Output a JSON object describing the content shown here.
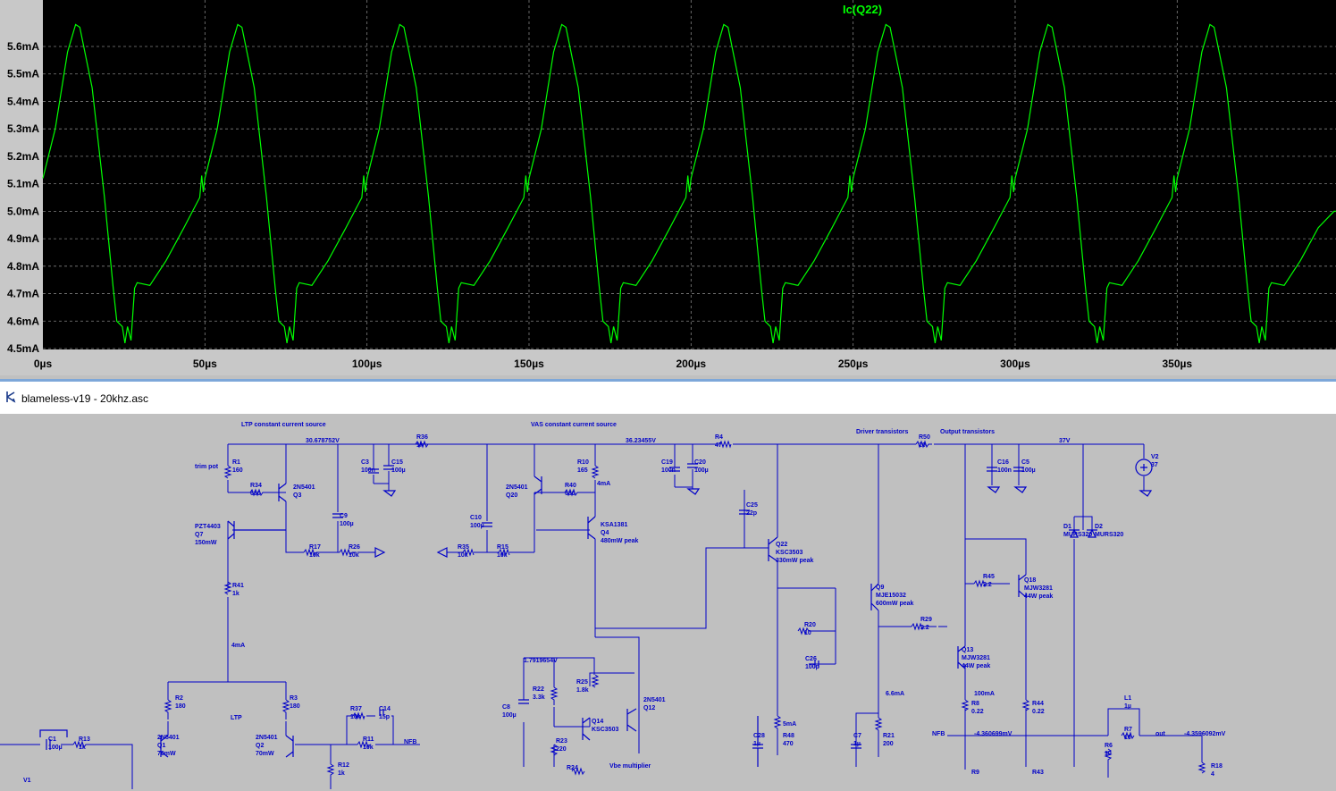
{
  "plot": {
    "trace_name": "Ic(Q22)",
    "trace_color": "#00ff00",
    "background": "#000000",
    "grid_color": "#808080"
  },
  "chart_data": {
    "type": "line",
    "title": "Ic(Q22)",
    "xlabel": "",
    "ylabel": "",
    "xlim": [
      0,
      399
    ],
    "ylim": [
      4.5,
      5.7
    ],
    "grid": true,
    "x_unit": "µs",
    "y_unit": "mA",
    "x_tick_labels": [
      "0µs",
      "50µs",
      "100µs",
      "150µs",
      "200µs",
      "250µs",
      "300µs",
      "350µs"
    ],
    "y_tick_labels": [
      "5.6mA",
      "5.5mA",
      "5.4mA",
      "5.3mA",
      "5.2mA",
      "5.1mA",
      "5.0mA",
      "4.9mA",
      "4.8mA",
      "4.7mA",
      "4.6mA",
      "4.5mA"
    ],
    "y_tick_values": [
      5.6,
      5.5,
      5.4,
      5.3,
      5.2,
      5.1,
      5.0,
      4.9,
      4.8,
      4.7,
      4.6,
      4.5
    ],
    "x_tick_values": [
      0,
      50,
      100,
      150,
      200,
      250,
      300,
      350
    ],
    "series": [
      {
        "name": "Ic(Q22)",
        "period_us": 50,
        "x": [
          0,
          3.8,
          7.6,
          10.1,
          11.4,
          15.2,
          19.0,
          21.7,
          22.8,
          24.5,
          25.3,
          26.1,
          27.2,
          28.3,
          29.1,
          33.0,
          38.0,
          43.5,
          48.4,
          49.0,
          49.5,
          50.0,
          53.8,
          57.6,
          60.1,
          61.4,
          65.2,
          69.0,
          71.7,
          72.8,
          74.5,
          75.3,
          76.1,
          77.2,
          78.3,
          79.1,
          83.0,
          88.0,
          93.5,
          98.4,
          99.0,
          99.5,
          100.0,
          103.8,
          107.6,
          110.1,
          111.4,
          115.2,
          119.0,
          121.7,
          122.8,
          124.5,
          125.3,
          126.1,
          127.2,
          128.3,
          129.1,
          133.0,
          138.0,
          143.5,
          148.4,
          149.0,
          149.5,
          150.0,
          153.8,
          157.6,
          160.1,
          161.4,
          165.2,
          169.0,
          171.7,
          172.8,
          174.5,
          175.3,
          176.1,
          177.2,
          178.3,
          179.1,
          183.0,
          188.0,
          193.5,
          198.4,
          199.0,
          199.5,
          200.0,
          203.8,
          207.6,
          210.1,
          211.4,
          215.2,
          219.0,
          221.7,
          222.8,
          224.5,
          225.3,
          226.1,
          227.2,
          228.3,
          229.1,
          233.0,
          238.0,
          243.5,
          248.4,
          249.0,
          249.5,
          250.0,
          253.8,
          257.6,
          260.1,
          261.4,
          265.2,
          269.0,
          271.7,
          272.8,
          274.5,
          275.3,
          276.1,
          277.2,
          278.3,
          279.1,
          283.0,
          288.0,
          293.5,
          298.4,
          299.0,
          299.5,
          300.0,
          303.8,
          307.6,
          310.1,
          311.4,
          315.2,
          319.0,
          321.7,
          322.8,
          324.5,
          325.3,
          326.1,
          327.2,
          328.3,
          329.1,
          333.0,
          338.0,
          343.5,
          348.4,
          349.0,
          349.5,
          350.0,
          353.8,
          357.6,
          360.1,
          361.4,
          365.2,
          369.0,
          371.7,
          372.8,
          374.5,
          375.3,
          376.1,
          377.2,
          378.3,
          379.1,
          383.0,
          388.0,
          393.5,
          398.4,
          399.0
        ],
        "y": [
          5.12,
          5.3,
          5.58,
          5.68,
          5.67,
          5.45,
          5.05,
          4.72,
          4.6,
          4.58,
          4.52,
          4.58,
          4.53,
          4.72,
          4.74,
          4.73,
          4.82,
          4.94,
          5.05,
          5.13,
          5.07,
          5.12,
          5.3,
          5.58,
          5.68,
          5.67,
          5.45,
          5.05,
          4.72,
          4.6,
          4.58,
          4.52,
          4.58,
          4.53,
          4.72,
          4.74,
          4.73,
          4.82,
          4.94,
          5.05,
          5.13,
          5.07,
          5.12,
          5.3,
          5.58,
          5.68,
          5.67,
          5.45,
          5.05,
          4.72,
          4.6,
          4.58,
          4.52,
          4.58,
          4.53,
          4.72,
          4.74,
          4.73,
          4.82,
          4.94,
          5.05,
          5.13,
          5.07,
          5.12,
          5.3,
          5.58,
          5.68,
          5.67,
          5.45,
          5.05,
          4.72,
          4.6,
          4.58,
          4.52,
          4.58,
          4.53,
          4.72,
          4.74,
          4.73,
          4.82,
          4.94,
          5.05,
          5.13,
          5.07,
          5.12,
          5.3,
          5.58,
          5.68,
          5.67,
          5.45,
          5.05,
          4.72,
          4.6,
          4.58,
          4.52,
          4.58,
          4.53,
          4.72,
          4.74,
          4.73,
          4.82,
          4.94,
          5.05,
          5.13,
          5.07,
          5.12,
          5.3,
          5.58,
          5.68,
          5.67,
          5.45,
          5.05,
          4.72,
          4.6,
          4.58,
          4.52,
          4.58,
          4.53,
          4.72,
          4.74,
          4.73,
          4.82,
          4.94,
          5.05,
          5.13,
          5.07,
          5.12,
          5.3,
          5.58,
          5.68,
          5.67,
          5.45,
          5.05,
          4.72,
          4.6,
          4.58,
          4.52,
          4.58,
          4.53,
          4.72,
          4.74,
          4.73,
          4.82,
          4.94,
          5.05,
          5.13,
          5.07,
          5.12,
          5.3,
          5.58,
          5.68,
          5.67,
          5.45,
          5.05,
          4.72,
          4.6,
          4.58,
          4.52,
          4.58,
          4.53,
          4.72,
          4.74,
          4.73,
          4.82,
          4.94,
          5.0,
          5.0
        ]
      }
    ]
  },
  "schematic": {
    "window_title": "blameless-v19 - 20khz.asc",
    "wire_color": "#0000c8",
    "labels": {
      "ltp_ccs": "LTP constant current source",
      "vas_ccs": "VAS constant current source",
      "driver": "Driver transistors",
      "output": "Output transistors",
      "ltp": "LTP",
      "vbe": "Vbe multiplier",
      "trim": "trim pot",
      "nfb1": "NFB",
      "nfb2": "NFB",
      "out": "out",
      "v_30": "30.678752V",
      "v_36": "36.23455V",
      "v_37": "37V",
      "v_179": "1.7919654V",
      "v_436": "-4.360699mV",
      "v_435": "-4.3596092mV",
      "i_4ma_a": "4mA",
      "i_4ma_b": "4mA",
      "i_5ma": "5mA",
      "i_66ma": "6.6mA",
      "i_100ma": "100mA"
    },
    "parts": [
      {
        "id": "r1",
        "name": "R1",
        "value": "160"
      },
      {
        "id": "r34",
        "name": "R34",
        "value": "680"
      },
      {
        "id": "q3",
        "name": "2N5401",
        "value": "Q3"
      },
      {
        "id": "q7",
        "name": "PZT4403",
        "value": "Q7",
        "power": "150mW"
      },
      {
        "id": "r17",
        "name": "R17",
        "value": "10k"
      },
      {
        "id": "r26",
        "name": "R26",
        "value": "10k"
      },
      {
        "id": "r41",
        "name": "R41",
        "value": "1k"
      },
      {
        "id": "c9",
        "name": "C9",
        "value": "100µ"
      },
      {
        "id": "c3",
        "name": "C3",
        "value": "100n"
      },
      {
        "id": "c15",
        "name": "C15",
        "value": "100µ"
      },
      {
        "id": "r36",
        "name": "R36",
        "value": "1k"
      },
      {
        "id": "c10",
        "name": "C10",
        "value": "100µ"
      },
      {
        "id": "r35",
        "name": "R35",
        "value": "10k"
      },
      {
        "id": "r15",
        "name": "R15",
        "value": "10k"
      },
      {
        "id": "q20",
        "name": "2N5401",
        "value": "Q20"
      },
      {
        "id": "r40",
        "name": "R40",
        "value": "680"
      },
      {
        "id": "r10",
        "name": "R10",
        "value": "165"
      },
      {
        "id": "q4",
        "name": "KSA1381",
        "value": "Q4",
        "power": "480mW peak"
      },
      {
        "id": "c19",
        "name": "C19",
        "value": "100n"
      },
      {
        "id": "c20",
        "name": "C20",
        "value": "100µ"
      },
      {
        "id": "r4",
        "name": "R4",
        "value": "47"
      },
      {
        "id": "c25",
        "name": "C25",
        "value": "22p"
      },
      {
        "id": "q22",
        "name": "Q22",
        "value": "KSC3503",
        "power": "330mW peak"
      },
      {
        "id": "r50",
        "name": "R50",
        "value": "10"
      },
      {
        "id": "c16",
        "name": "C16",
        "value": "100n"
      },
      {
        "id": "c5",
        "name": "C5",
        "value": "100µ"
      },
      {
        "id": "v2",
        "name": "V2",
        "value": "37"
      },
      {
        "id": "d1",
        "name": "D1",
        "value": "MURS320"
      },
      {
        "id": "d2",
        "name": "D2",
        "value": "MURS320"
      },
      {
        "id": "q9",
        "name": "Q9",
        "value": "MJE15032",
        "power": "600mW peak"
      },
      {
        "id": "r20",
        "name": "R20",
        "value": "10"
      },
      {
        "id": "c26",
        "name": "C26",
        "value": "100p"
      },
      {
        "id": "r45",
        "name": "R45",
        "value": "2.2"
      },
      {
        "id": "q18",
        "name": "Q18",
        "value": "MJW3281",
        "power": "44W peak"
      },
      {
        "id": "r29",
        "name": "R29",
        "value": "2.2"
      },
      {
        "id": "q13",
        "name": "Q13",
        "value": "MJW3281",
        "power": "44W peak"
      },
      {
        "id": "r8",
        "name": "R8",
        "value": "0.22"
      },
      {
        "id": "r44",
        "name": "R44",
        "value": "0.22"
      },
      {
        "id": "r9",
        "name": "R9",
        "value": ""
      },
      {
        "id": "r43",
        "name": "R43",
        "value": ""
      },
      {
        "id": "l1",
        "name": "L1",
        "value": "1µ"
      },
      {
        "id": "r7",
        "name": "R7",
        "value": "10"
      },
      {
        "id": "r6",
        "name": "R6",
        "value": "10"
      },
      {
        "id": "r18",
        "name": "R18",
        "value": "4"
      },
      {
        "id": "c7",
        "name": "C7",
        "value": "1µ"
      },
      {
        "id": "r21",
        "name": "R21",
        "value": "200"
      },
      {
        "id": "c28",
        "name": "C28",
        "value": "1µ"
      },
      {
        "id": "r48",
        "name": "R48",
        "value": "470"
      },
      {
        "id": "r25",
        "name": "R25",
        "value": "1.8k"
      },
      {
        "id": "r22",
        "name": "R22",
        "value": "3.3k"
      },
      {
        "id": "c8",
        "name": "C8",
        "value": "100µ"
      },
      {
        "id": "q14",
        "name": "Q14",
        "value": "KSC3503"
      },
      {
        "id": "q12",
        "name": "2N5401",
        "value": "Q12"
      },
      {
        "id": "r23",
        "name": "R23",
        "value": "220"
      },
      {
        "id": "r24",
        "name": "R24",
        "value": ""
      },
      {
        "id": "r2",
        "name": "R2",
        "value": "180"
      },
      {
        "id": "r3",
        "name": "R3",
        "value": "180"
      },
      {
        "id": "q1",
        "name": "2N5401",
        "value": "Q1",
        "power": "70mW"
      },
      {
        "id": "q2",
        "name": "2N5401",
        "value": "Q2",
        "power": "70mW"
      },
      {
        "id": "r37",
        "name": "R37",
        "value": "10k"
      },
      {
        "id": "c14",
        "name": "C14",
        "value": "15p"
      },
      {
        "id": "r11",
        "name": "R11",
        "value": "10k"
      },
      {
        "id": "r12",
        "name": "R12",
        "value": "1k"
      },
      {
        "id": "c1",
        "name": "C1",
        "value": "100µ"
      },
      {
        "id": "r13",
        "name": "R13",
        "value": "1k"
      },
      {
        "id": "v1",
        "name": "V1",
        "value": ""
      }
    ]
  }
}
